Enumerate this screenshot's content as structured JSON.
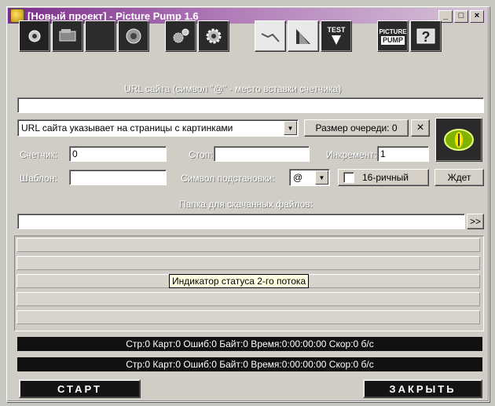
{
  "window": {
    "title": "[Новый проект] - Picture Pump 1.6",
    "minimize": "_",
    "maximize": "□",
    "close": "×"
  },
  "toolbar": {
    "icons": [
      "new-project-icon",
      "open-project-icon",
      "blank-icon",
      "save-project-icon",
      "settings-icon",
      "gear-icon",
      "graph-icon",
      "layers-icon",
      "test-icon",
      "picture-pump-logo-icon",
      "help-icon"
    ],
    "test_label": "TEST",
    "logo_top": "PICTURE",
    "logo_bottom": "PUMP"
  },
  "url": {
    "label": "URL сайта (символ \"@\" - место вставки счетчика)",
    "value": ""
  },
  "mode": {
    "selected": "URL сайта указывает на страницы с картинками",
    "queue_label": "Размер очереди: 0",
    "clear_label": "×"
  },
  "counter": {
    "label": "Счетчик:",
    "value": "0",
    "stop_label": "Стоп:",
    "stop_value": "",
    "increment_label": "Инкремент:",
    "increment_value": "1"
  },
  "template": {
    "label": "Шаблон:",
    "value": "",
    "subst_label": "Символ подстановки:",
    "subst_value": "@",
    "hex_label": "16-ричный",
    "wait_label": "Ждет"
  },
  "folder": {
    "label": "Папка для скачанных файлов:",
    "value": "",
    "browse_label": ">>"
  },
  "threads": {
    "tooltip": "Индикатор статуса 2-го потока"
  },
  "status": {
    "line1": "Стр:0 Карт:0 Ошиб:0 Байт:0 Время:0:00:00:00 Скор:0 б/с",
    "line2": "Стр:0 Карт:0 Ошиб:0 Байт:0 Время:0:00:00:00 Скор:0 б/с"
  },
  "actions": {
    "start": "СТАРТ",
    "close": "ЗАКРЫТЬ"
  }
}
